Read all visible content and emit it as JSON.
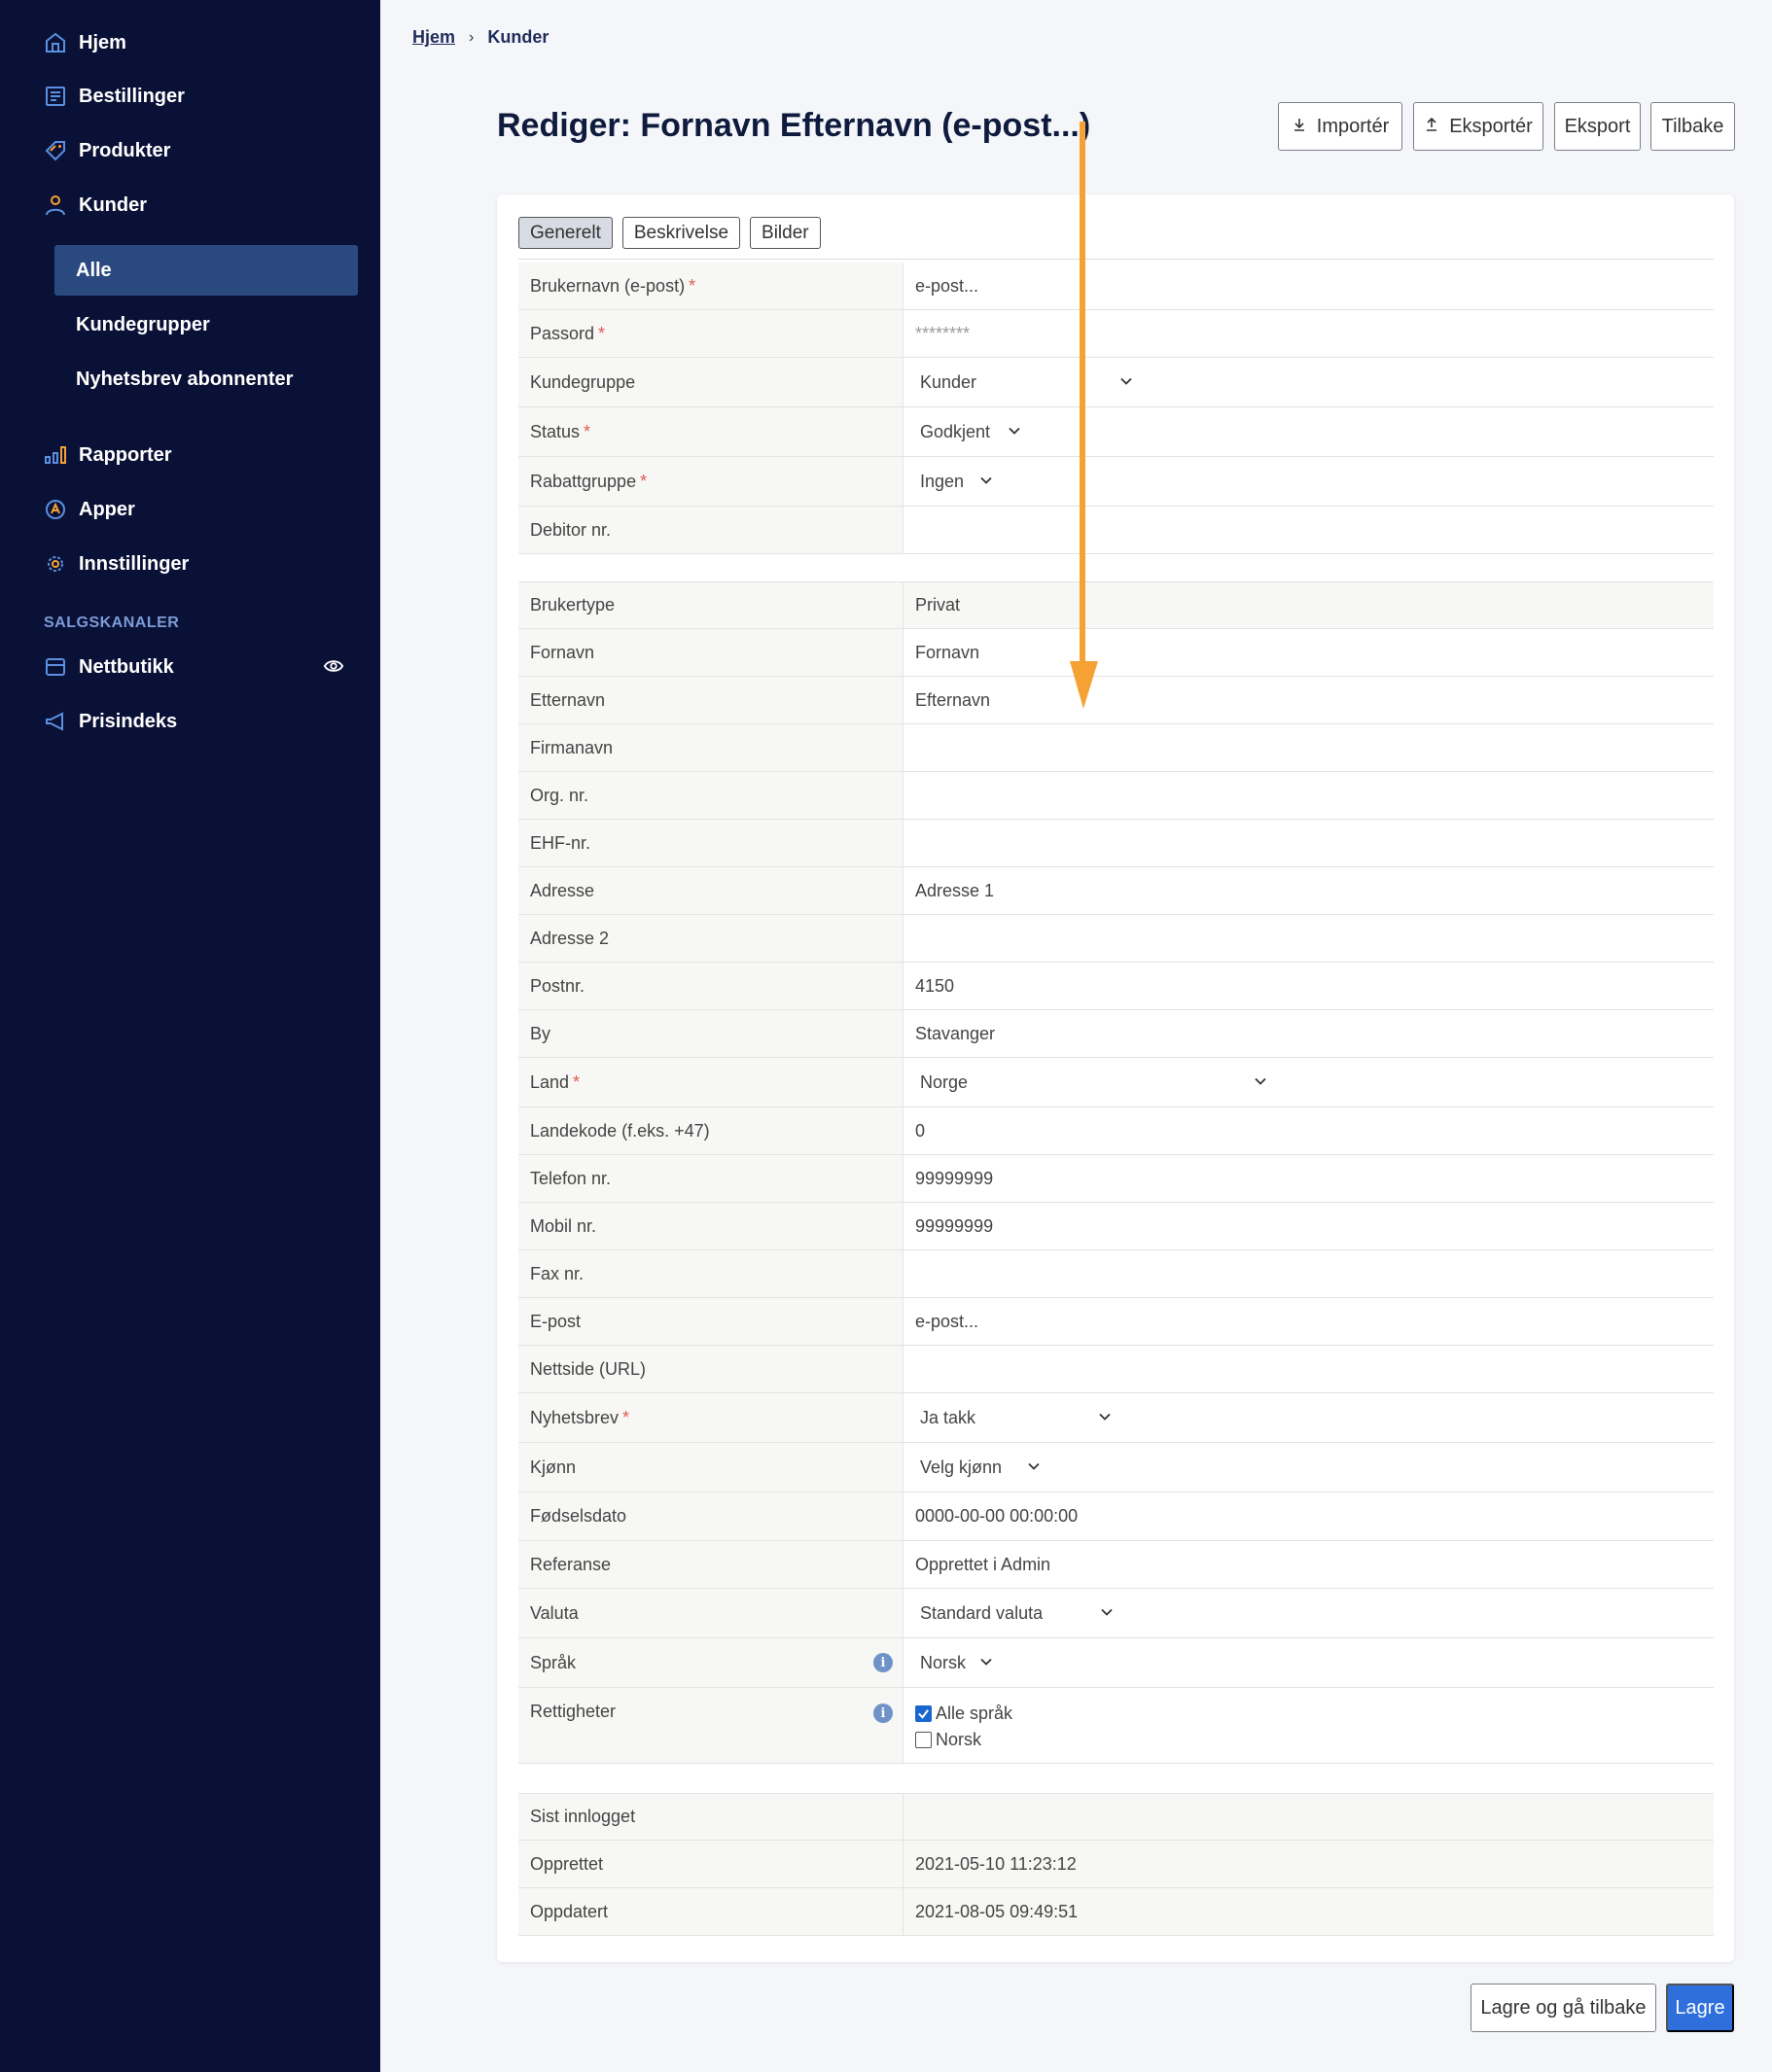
{
  "sidebar": {
    "items": [
      {
        "label": "Hjem",
        "icon": "home-icon"
      },
      {
        "label": "Bestillinger",
        "icon": "orders-icon"
      },
      {
        "label": "Produkter",
        "icon": "tag-icon"
      },
      {
        "label": "Kunder",
        "icon": "user-icon"
      }
    ],
    "sub_items": [
      {
        "label": "Alle",
        "active": true
      },
      {
        "label": "Kundegrupper",
        "active": false
      },
      {
        "label": "Nyhetsbrev abonnenter",
        "active": false
      }
    ],
    "items2": [
      {
        "label": "Rapporter",
        "icon": "bar-chart-icon"
      },
      {
        "label": "Apper",
        "icon": "apps-icon"
      },
      {
        "label": "Innstillinger",
        "icon": "gear-icon"
      }
    ],
    "section_label": "SALGSKANALER",
    "channels": [
      {
        "label": "Nettbutikk",
        "icon": "store-icon"
      },
      {
        "label": "Prisindeks",
        "icon": "megaphone-icon"
      }
    ]
  },
  "breadcrumb": {
    "home": "Hjem",
    "separator": "›",
    "current": "Kunder"
  },
  "page_title": "Rediger: Fornavn Efternavn (e-post...)",
  "toolbar": {
    "import": "Importér",
    "export": "Eksportér",
    "export2": "Eksport",
    "back": "Tilbake"
  },
  "tabs": [
    "Generelt",
    "Beskrivelse",
    "Bilder"
  ],
  "fields": {
    "brukernavn": {
      "label": "Brukernavn (e-post)",
      "value": "e-post..."
    },
    "passord": {
      "label": "Passord",
      "value": "********"
    },
    "kundegruppe": {
      "label": "Kundegruppe",
      "value": "Kunder"
    },
    "status": {
      "label": "Status",
      "value": "Godkjent"
    },
    "rabattgruppe": {
      "label": "Rabattgruppe",
      "value": "Ingen"
    },
    "debitor": {
      "label": "Debitor nr.",
      "value": ""
    },
    "brukertype": {
      "label": "Brukertype",
      "value": "Privat"
    },
    "fornavn": {
      "label": "Fornavn",
      "value": "Fornavn"
    },
    "etternavn": {
      "label": "Etternavn",
      "value": "Efternavn"
    },
    "firmanavn": {
      "label": "Firmanavn",
      "value": ""
    },
    "orgnr": {
      "label": "Org. nr.",
      "value": ""
    },
    "ehf": {
      "label": "EHF-nr.",
      "value": ""
    },
    "adresse": {
      "label": "Adresse",
      "value": "Adresse 1"
    },
    "adresse2": {
      "label": "Adresse 2",
      "value": ""
    },
    "postnr": {
      "label": "Postnr.",
      "value": "4150"
    },
    "by": {
      "label": "By",
      "value": "Stavanger"
    },
    "land": {
      "label": "Land",
      "value": "Norge"
    },
    "landekode": {
      "label": "Landekode (f.eks. +47)",
      "value": "0"
    },
    "telefon": {
      "label": "Telefon nr.",
      "value": "99999999"
    },
    "mobil": {
      "label": "Mobil nr.",
      "value": "99999999"
    },
    "fax": {
      "label": "Fax nr.",
      "value": ""
    },
    "epost": {
      "label": "E-post",
      "value": "e-post..."
    },
    "nettside": {
      "label": "Nettside (URL)",
      "value": ""
    },
    "nyhetsbrev": {
      "label": "Nyhetsbrev",
      "value": "Ja takk"
    },
    "kjonn": {
      "label": "Kjønn",
      "value": "Velg kjønn"
    },
    "fodselsdato": {
      "label": "Fødselsdato",
      "value": "0000-00-00 00:00:00"
    },
    "referanse": {
      "label": "Referanse",
      "value": "Opprettet i Admin"
    },
    "valuta": {
      "label": "Valuta",
      "value": "Standard valuta"
    },
    "sprak": {
      "label": "Språk",
      "value": "Norsk"
    },
    "rettigheter": {
      "label": "Rettigheter",
      "options": [
        "Alle språk",
        "Norsk"
      ]
    },
    "sist_innlogget": {
      "label": "Sist innlogget",
      "value": ""
    },
    "opprettet": {
      "label": "Opprettet",
      "value": "2021-05-10 11:23:12"
    },
    "oppdatert": {
      "label": "Oppdatert",
      "value": "2021-08-05 09:49:51"
    }
  },
  "required_marker": "*",
  "info_marker": "i",
  "footer": {
    "save_back": "Lagre og gå tilbake",
    "save": "Lagre"
  },
  "colors": {
    "sidebar_bg": "#0a1136",
    "accent": "#2f6fdc",
    "annotation_arrow": "#f5a133",
    "icon_blue": "#5b8fe0"
  }
}
